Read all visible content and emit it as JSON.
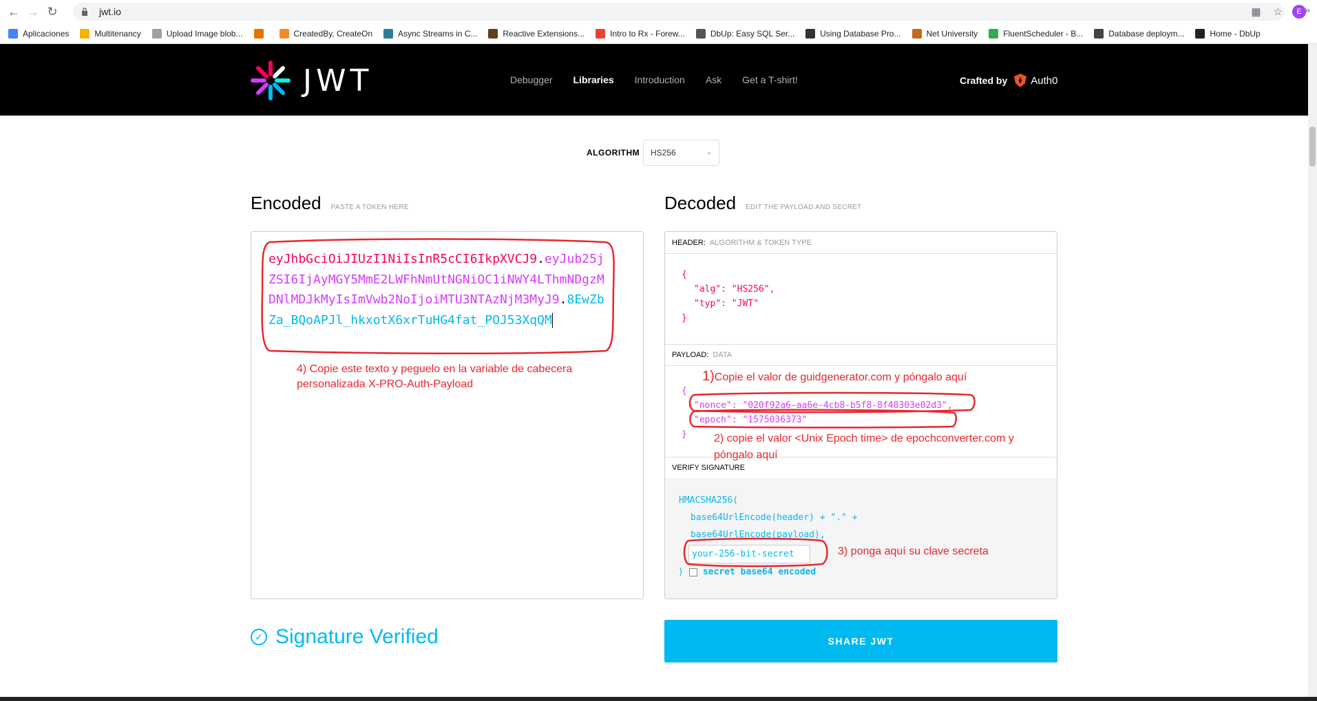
{
  "browser": {
    "url": "jwt.io",
    "profile_initial": "E",
    "bookmarks": [
      {
        "label": "Aplicaciones",
        "color": "#4285f4"
      },
      {
        "label": "Multitenancy",
        "color": "#f4b400"
      },
      {
        "label": "Upload Image blob...",
        "color": "#9aa0a6"
      },
      {
        "label": "",
        "color": "#e37400"
      },
      {
        "label": "CreatedBy, CreateOn",
        "color": "#f28b30"
      },
      {
        "label": "Async Streams in C...",
        "color": "#2d7d9a"
      },
      {
        "label": "Reactive Extensions...",
        "color": "#5f3f1f"
      },
      {
        "label": "Intro to Rx - Forew...",
        "color": "#ea4335"
      },
      {
        "label": "DbUp: Easy SQL Ser...",
        "color": "#555555"
      },
      {
        "label": "Using Database Pro...",
        "color": "#333333"
      },
      {
        "label": "Net University",
        "color": "#c26a1b"
      },
      {
        "label": "FluentScheduler - B...",
        "color": "#34a853"
      },
      {
        "label": "Database deploym...",
        "color": "#444444"
      },
      {
        "label": "Home - DbUp",
        "color": "#222222"
      }
    ]
  },
  "site": {
    "logo_text": "JWT",
    "nav": [
      "Debugger",
      "Libraries",
      "Introduction",
      "Ask",
      "Get a T-shirt!"
    ],
    "active_nav": "Libraries",
    "crafted_by": "Crafted by",
    "auth0": "Auth0"
  },
  "algorithm": {
    "label": "ALGORITHM",
    "value": "HS256"
  },
  "encoded": {
    "title": "Encoded",
    "subtitle": "PASTE A TOKEN HERE",
    "header_part": "eyJhbGciOiJIUzI1NiIsInR5cCI6IkpXVCJ9",
    "payload_part": "eyJub25jZSI6IjAyMGY5MmE2LWFhNmUtNGNiOC1iNWY4LThmNDgzMDNlMDJkMyIsImVwb2NoIjoiMTU3NTAzNjM3MyJ9",
    "signature_part": "8EwZbZa_BQoAPJl_hkxotX6xrTuHG4fat_POJ53XqQM",
    "dot": "."
  },
  "decoded": {
    "title": "Decoded",
    "subtitle": "EDIT THE PAYLOAD AND SECRET",
    "header_label": "HEADER:",
    "header_sub": "ALGORITHM & TOKEN TYPE",
    "header_json": {
      "alg_key": "\"alg\": ",
      "alg_val": "\"HS256\",",
      "typ_key": "\"typ\": ",
      "typ_val": "\"JWT\""
    },
    "payload_label": "PAYLOAD:",
    "payload_sub": "DATA",
    "payload_json": {
      "nonce_key": "\"nonce\": ",
      "nonce_val": "\"020f92a6-aa6e-4cb8-b5f8-8f48303e02d3\",",
      "epoch_key": "\"epoch\": ",
      "epoch_val": "\"1575036373\""
    },
    "verify_label": "VERIFY SIGNATURE",
    "sig_fn": "HMACSHA256(",
    "sig_line1": "base64UrlEncode(header) + \".\" +",
    "sig_line2": "base64UrlEncode(payload),",
    "secret_value": "your-256-bit-secret",
    "close_paren": ")",
    "b64_label": "secret base64 encoded"
  },
  "status": {
    "verified": "Signature Verified"
  },
  "share": {
    "label": "SHARE JWT"
  },
  "annotations": {
    "a1_num": "1)",
    "a1": "Copie el valor de guidgenerator.com y póngalo aquí",
    "a2_line1": "2) copie el valor <Unix Epoch time> de epochconverter.com y",
    "a2_line2": "póngalo aquí",
    "a3": "3) ponga aquí su clave secreta",
    "a4_line1": "4) Copie este texto y peguelo en la variable de cabecera",
    "a4_line2": "personalizada X-PRO-Auth-Payload",
    "color": "#e8262c"
  },
  "colors": {
    "header_red": "#fb015b",
    "payload_purple": "#d63aff",
    "signature_blue": "#00b9f1"
  }
}
